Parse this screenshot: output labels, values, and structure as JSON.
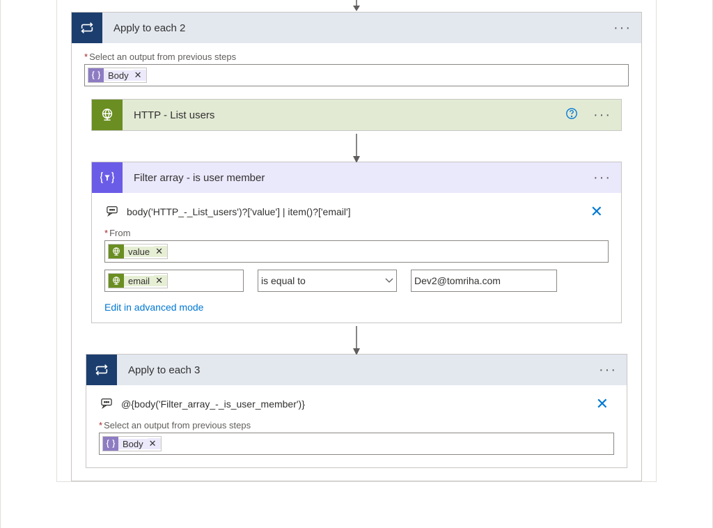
{
  "applyToEach2": {
    "title": "Apply to each 2",
    "selectOutputLabel": "Select an output from previous steps",
    "token": "Body"
  },
  "httpListUsers": {
    "title": "HTTP - List users"
  },
  "filterArray": {
    "title": "Filter array - is user member",
    "expressionText": "body('HTTP_-_List_users')?['value'] | item()?['email']",
    "fromLabel": "From",
    "fromToken": "value",
    "conditionLeftToken": "email",
    "conditionOperator": "is equal to",
    "conditionRight": "Dev2@tomriha.com",
    "editAdvanced": "Edit in advanced mode"
  },
  "applyToEach3": {
    "title": "Apply to each 3",
    "expressionText": "@{body('Filter_array_-_is_user_member')}",
    "selectOutputLabel": "Select an output from previous steps",
    "token": "Body"
  }
}
